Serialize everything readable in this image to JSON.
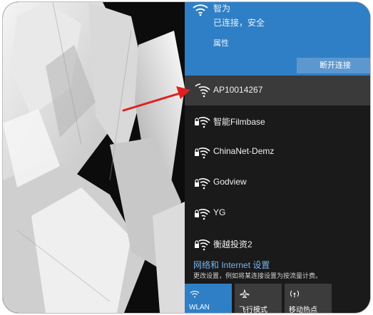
{
  "connected_network": {
    "name": "智为",
    "status": "已连接，安全",
    "properties_label": "属性",
    "disconnect_label": "断开连接"
  },
  "networks": [
    {
      "name": "AP10014267",
      "selected": true,
      "secured": false
    },
    {
      "name": "智能Filmbase",
      "selected": false,
      "secured": true
    },
    {
      "name": "ChinaNet-Demz",
      "selected": false,
      "secured": true
    },
    {
      "name": "Godview",
      "selected": false,
      "secured": true
    },
    {
      "name": "YG",
      "selected": false,
      "secured": true
    },
    {
      "name": "衡越投资2",
      "selected": false,
      "secured": true
    }
  ],
  "settings": {
    "title": "网络和 Internet 设置",
    "description": "更改设置，例如将某连接设置为按流量计费。"
  },
  "quick_actions": [
    {
      "label": "WLAN",
      "icon": "wifi-icon",
      "active": true
    },
    {
      "label": "飞行模式",
      "icon": "airplane-icon",
      "active": false
    },
    {
      "label": "移动热点",
      "icon": "hotspot-icon",
      "active": false
    }
  ],
  "colors": {
    "accent": "#2f7fc6",
    "panel_bg": "#1a1a1a",
    "selected_row": "#3a3a3a",
    "link": "#78b4ee",
    "arrow": "#e02020"
  }
}
